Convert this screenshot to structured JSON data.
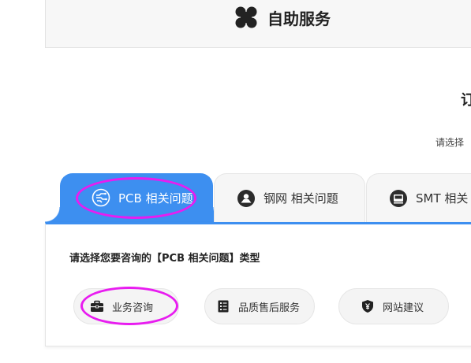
{
  "header": {
    "icon": "four-petal-grid-icon",
    "title": "自助服务"
  },
  "section": {
    "title_fragment": "订",
    "subtitle_fragment": "请选择"
  },
  "tabs": [
    {
      "label": "PCB 相关问题",
      "icon": "pcb-circuit-icon",
      "active": true
    },
    {
      "label": "钢网 相关问题",
      "icon": "stencil-icon",
      "active": false
    },
    {
      "label": "SMT 相关",
      "icon": "smt-machine-icon",
      "active": false
    }
  ],
  "panel": {
    "prompt": "请选择您要咨询的【PCB 相关问题】类型",
    "options": [
      {
        "label": "业务咨询",
        "icon": "briefcase-icon"
      },
      {
        "label": "品质售后服务",
        "icon": "checklist-icon"
      },
      {
        "label": "网站建议",
        "icon": "shield-yen-icon"
      }
    ]
  },
  "colors": {
    "accent": "#3d8ff0",
    "highlight": "#e81cf0",
    "tab_inactive_bg": "#f6f6f6",
    "pill_bg": "#f4f4f4"
  }
}
